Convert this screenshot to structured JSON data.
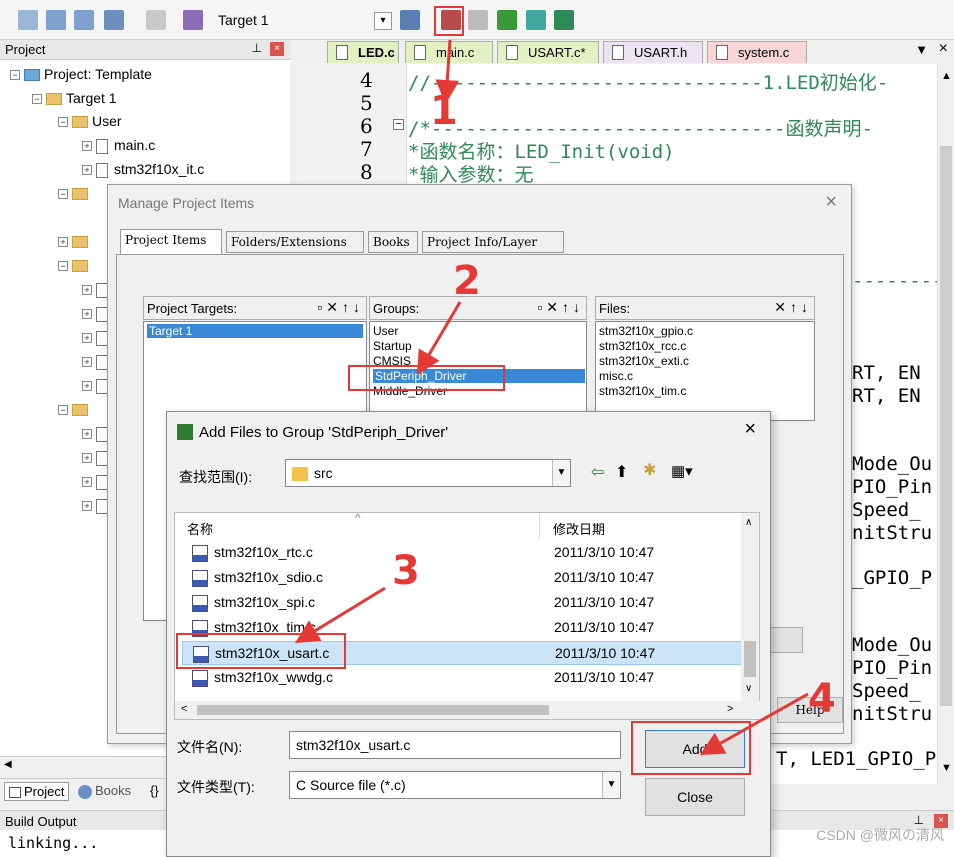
{
  "toolbar": {
    "target": "Target 1"
  },
  "project_panel": {
    "title": "Project",
    "tree": [
      {
        "label": "Project: Template",
        "level": 0
      },
      {
        "label": "Target 1",
        "level": 1
      },
      {
        "label": "User",
        "level": 2
      },
      {
        "label": "main.c",
        "level": 3
      },
      {
        "label": "stm32f10x_it.c",
        "level": 3
      }
    ],
    "bottom_tabs": [
      "Project",
      "Books",
      "{}"
    ]
  },
  "editor": {
    "tabs": [
      "LED.c",
      "main.c",
      "USART.c*",
      "USART.h",
      "system.c"
    ],
    "line_numbers": [
      "4",
      "5",
      "6",
      "7",
      "8"
    ],
    "lines": [
      "//-----------------------------1.LED初始化-",
      "",
      "/*-------------------------------函数声明-",
      "*函数名称：LED_Init(void)",
      "*输入参数：无"
    ],
    "right_fragments": [
      "RT, EN",
      "RT, EN",
      "Mode_Ou",
      "PIO_Pin",
      "Speed_",
      "nitStru",
      "_GPIO_P",
      "Mode_Ou",
      "PIO_Pin",
      "Speed_",
      "nitStru",
      "T, LED1_GPIO_P"
    ]
  },
  "manage_dialog": {
    "title": "Manage Project Items",
    "tabs": [
      "Project Items",
      "Folders/Extensions",
      "Books",
      "Project Info/Layer"
    ],
    "targets_label": "Project Targets:",
    "targets": [
      "Target 1"
    ],
    "groups_label": "Groups:",
    "groups": [
      "User",
      "Startup",
      "CMSIS",
      "StdPeriph_Driver",
      "Middle_Driver"
    ],
    "files_label": "Files:",
    "files": [
      "stm32f10x_gpio.c",
      "stm32f10x_rcc.c",
      "stm32f10x_exti.c",
      "misc.c",
      "stm32f10x_tim.c"
    ],
    "help": "Help"
  },
  "add_dialog": {
    "title": "Add Files to Group 'StdPeriph_Driver'",
    "look_in_label": "查找范围(I):",
    "look_in_value": "src",
    "col_name": "名称",
    "col_date": "修改日期",
    "files": [
      {
        "name": "stm32f10x_rtc.c",
        "date": "2011/3/10 10:47"
      },
      {
        "name": "stm32f10x_sdio.c",
        "date": "2011/3/10 10:47"
      },
      {
        "name": "stm32f10x_spi.c",
        "date": "2011/3/10 10:47"
      },
      {
        "name": "stm32f10x_tim.c",
        "date": "2011/3/10 10:47"
      },
      {
        "name": "stm32f10x_usart.c",
        "date": "2011/3/10 10:47"
      },
      {
        "name": "stm32f10x_wwdg.c",
        "date": "2011/3/10 10:47"
      }
    ],
    "filename_label": "文件名(N):",
    "filename_value": "stm32f10x_usart.c",
    "filetype_label": "文件类型(T):",
    "filetype_value": "C Source file (*.c)",
    "add_button": "Add",
    "close_button": "Close"
  },
  "annotations": [
    "1",
    "2",
    "3",
    "4"
  ],
  "build": {
    "title": "Build Output",
    "text": "linking..."
  },
  "watermark": "CSDN @微风の清风"
}
